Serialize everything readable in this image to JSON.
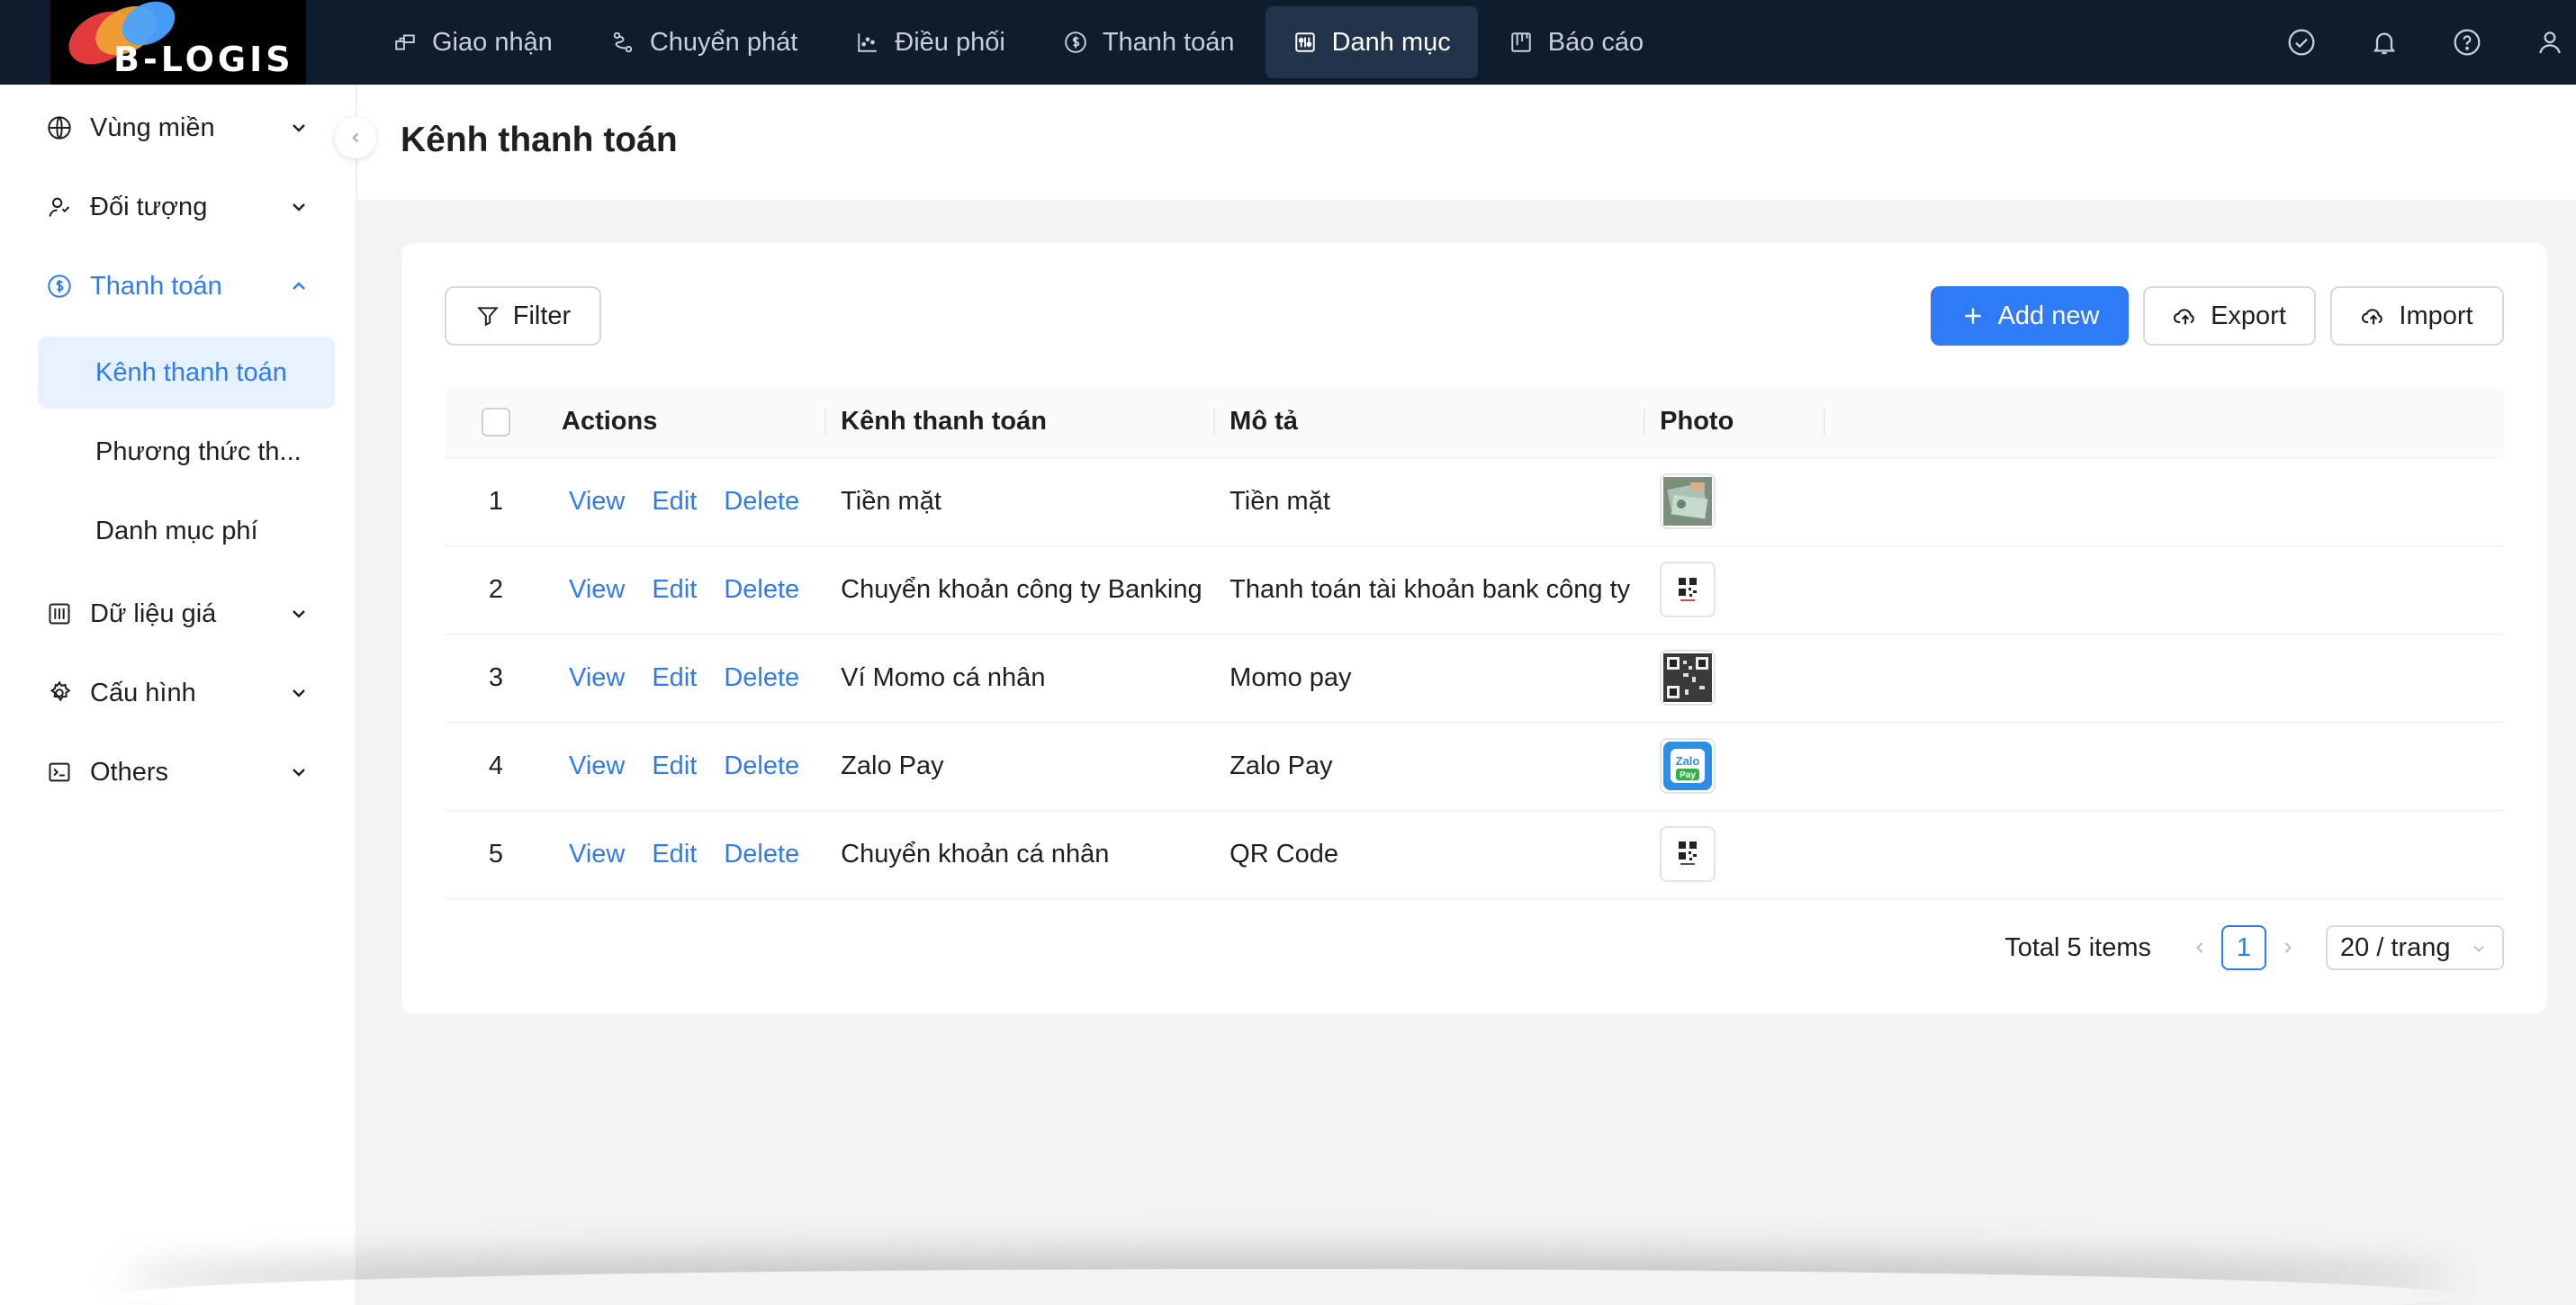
{
  "app": {
    "logo_text": "B-LOGIS"
  },
  "nav": {
    "items": [
      {
        "label": "Giao nhận",
        "icon": "handover-icon"
      },
      {
        "label": "Chuyển phát",
        "icon": "route-icon"
      },
      {
        "label": "Điều phối",
        "icon": "chart-scatter-icon"
      },
      {
        "label": "Thanh toán",
        "icon": "dollar-circle-icon"
      },
      {
        "label": "Danh mục",
        "icon": "sliders-icon",
        "active": true
      },
      {
        "label": "Báo cáo",
        "icon": "board-icon"
      }
    ]
  },
  "sidebar": {
    "items": [
      {
        "label": "Vùng miền",
        "icon": "globe-icon"
      },
      {
        "label": "Đối tượng",
        "icon": "users-icon"
      },
      {
        "label": "Thanh toán",
        "icon": "dollar-circle-icon",
        "open": true
      },
      {
        "label": "Dữ liệu giá",
        "icon": "price-data-icon"
      },
      {
        "label": "Cấu hình",
        "icon": "gear-icon"
      },
      {
        "label": "Others",
        "icon": "terminal-icon"
      }
    ],
    "sub_items": [
      {
        "label": "Kênh thanh toán",
        "selected": true
      },
      {
        "label": "Phương thức th..."
      },
      {
        "label": "Danh mục phí"
      }
    ]
  },
  "page": {
    "title": "Kênh thanh toán"
  },
  "toolbar": {
    "filter_label": "Filter",
    "add_label": "Add new",
    "export_label": "Export",
    "import_label": "Import"
  },
  "table": {
    "headers": {
      "actions": "Actions",
      "channel": "Kênh thanh toán",
      "description": "Mô tả",
      "photo": "Photo"
    },
    "action_labels": {
      "view": "View",
      "edit": "Edit",
      "delete": "Delete"
    },
    "rows": [
      {
        "no": "1",
        "channel": "Tiền mặt",
        "description": "Tiền mặt",
        "photo": "cash-photo"
      },
      {
        "no": "2",
        "channel": "Chuyển khoản công ty Banking",
        "description": "Thanh toán tài khoản bank công ty",
        "photo": "qr-photo"
      },
      {
        "no": "3",
        "channel": "Ví Momo cá nhân",
        "description": "Momo pay",
        "photo": "qr-photo"
      },
      {
        "no": "4",
        "channel": "Zalo Pay",
        "description": "Zalo Pay",
        "photo": "zalopay-photo"
      },
      {
        "no": "5",
        "channel": "Chuyển khoản cá nhân",
        "description": "QR Code",
        "photo": "qr-photo"
      }
    ]
  },
  "zalopay_logo": {
    "line1": "Zalo",
    "line2": "Pay"
  },
  "pagination": {
    "total": "Total 5 items",
    "current": "1",
    "page_size": "20 / trang"
  },
  "colors": {
    "accent": "#2f7bf6",
    "topbar": "#0f1c2e",
    "selected_bg": "#e7f1ff"
  }
}
